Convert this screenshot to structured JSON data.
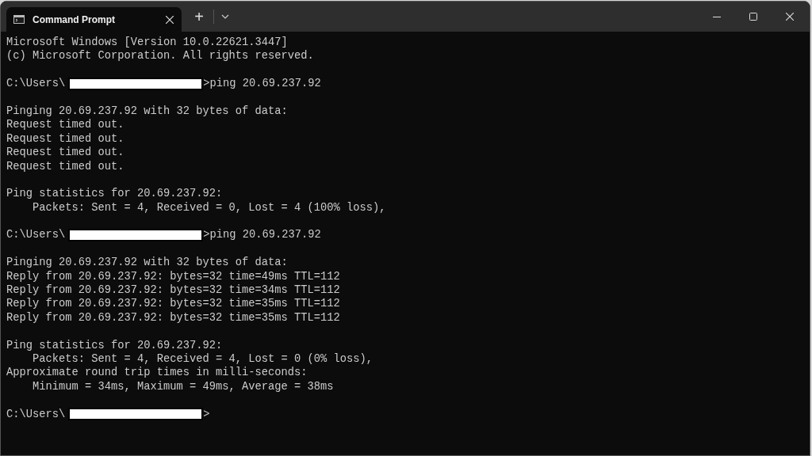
{
  "tabs": [
    {
      "title": "Command Prompt",
      "selected": true
    }
  ],
  "new_tab": "+",
  "lines": [
    {
      "kind": "text",
      "text": "Microsoft Windows [Version 10.0.22621.3447]"
    },
    {
      "kind": "text",
      "text": "(c) Microsoft Corporation. All rights reserved."
    },
    {
      "kind": "blank"
    },
    {
      "kind": "prompt",
      "prefix": "C:\\Users\\",
      "command": ">ping 20.69.237.92"
    },
    {
      "kind": "blank"
    },
    {
      "kind": "text",
      "text": "Pinging 20.69.237.92 with 32 bytes of data:"
    },
    {
      "kind": "text",
      "text": "Request timed out."
    },
    {
      "kind": "text",
      "text": "Request timed out."
    },
    {
      "kind": "text",
      "text": "Request timed out."
    },
    {
      "kind": "text",
      "text": "Request timed out."
    },
    {
      "kind": "blank"
    },
    {
      "kind": "text",
      "text": "Ping statistics for 20.69.237.92:"
    },
    {
      "kind": "text",
      "text": "    Packets: Sent = 4, Received = 0, Lost = 4 (100% loss),"
    },
    {
      "kind": "blank"
    },
    {
      "kind": "prompt",
      "prefix": "C:\\Users\\",
      "command": ">ping 20.69.237.92"
    },
    {
      "kind": "blank"
    },
    {
      "kind": "text",
      "text": "Pinging 20.69.237.92 with 32 bytes of data:"
    },
    {
      "kind": "text",
      "text": "Reply from 20.69.237.92: bytes=32 time=49ms TTL=112"
    },
    {
      "kind": "text",
      "text": "Reply from 20.69.237.92: bytes=32 time=34ms TTL=112"
    },
    {
      "kind": "text",
      "text": "Reply from 20.69.237.92: bytes=32 time=35ms TTL=112"
    },
    {
      "kind": "text",
      "text": "Reply from 20.69.237.92: bytes=32 time=35ms TTL=112"
    },
    {
      "kind": "blank"
    },
    {
      "kind": "text",
      "text": "Ping statistics for 20.69.237.92:"
    },
    {
      "kind": "text",
      "text": "    Packets: Sent = 4, Received = 4, Lost = 0 (0% loss),"
    },
    {
      "kind": "text",
      "text": "Approximate round trip times in milli-seconds:"
    },
    {
      "kind": "text",
      "text": "    Minimum = 34ms, Maximum = 49ms, Average = 38ms"
    },
    {
      "kind": "blank"
    },
    {
      "kind": "prompt",
      "prefix": "C:\\Users\\",
      "command": ">"
    }
  ]
}
